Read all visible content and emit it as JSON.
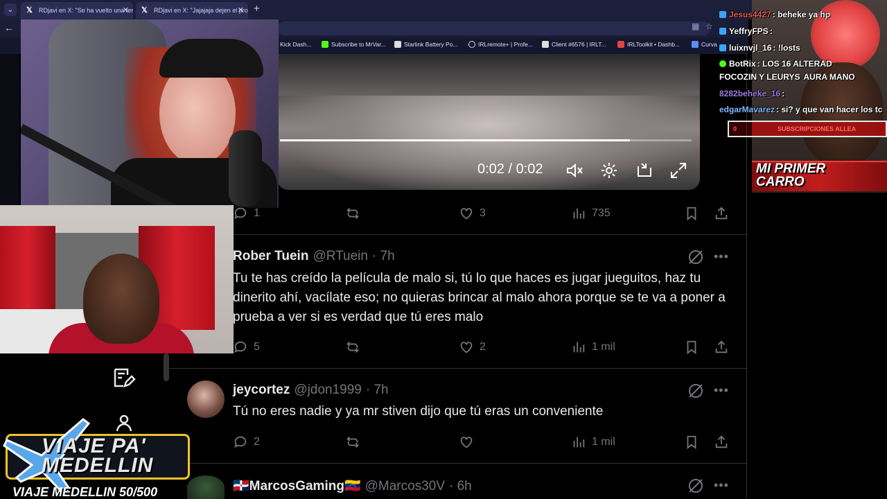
{
  "browser": {
    "tabs": [
      {
        "label": "RDjavi en X: \"Se ha vuelto una terc"
      },
      {
        "label": "RDjavi en X: \"Jajajaja dejen el prob"
      }
    ],
    "bookmarks": [
      {
        "label": "Kick Dash..."
      },
      {
        "label": "Subscribe to MrVar..."
      },
      {
        "label": "Starlink Battery Po..."
      },
      {
        "label": "IRLremote+ | Profe..."
      },
      {
        "label": "Client #6576 | IRLT..."
      },
      {
        "label": "IRLToolkit • Dashb..."
      },
      {
        "label": "Curva"
      }
    ]
  },
  "header": {
    "fragment": "t"
  },
  "video": {
    "time": "0:02 / 0:02",
    "progress_fraction": 0.85,
    "icons": [
      "mute-icon",
      "settings-icon",
      "pip-icon",
      "fullscreen-icon"
    ]
  },
  "post_actions": {
    "replies": "1",
    "likes": "3",
    "views": "735"
  },
  "replies": [
    {
      "name": "Rober Tuein",
      "handle": "@RTuein",
      "time": "· 7h",
      "text": "Tu te has creído la película de malo si, tú lo que haces es jugar jueguitos, haz tu dinerito ahí, vacílate eso; no quieras brincar al malo ahora porque se te va a poner a prueba a ver si es verdad que tú eres malo",
      "reply_count": "5",
      "like_count": "2",
      "views": "1 mil"
    },
    {
      "name": "jeycortez",
      "handle": "@jdon1999",
      "time": "· 7h",
      "text": "Tú no eres nadie y ya mr stiven dijo que tú eras un conveniente",
      "reply_count": "2",
      "like_count": "",
      "views": "1 mil"
    },
    {
      "name": "MarcosGaming",
      "handle": "@Marcos30V",
      "time": "· 6h",
      "flag_left": "🇩🇴",
      "flag_right": "🇻🇪"
    }
  ],
  "chat": [
    {
      "user": "Jesus4427",
      "message": ": beheke ya hp",
      "color": "#e05a5a"
    },
    {
      "user": "YeffryFPS",
      "message": ":",
      "color": "#ffffff"
    },
    {
      "user": "luixnvjl_16",
      "message": ": !losts",
      "color": "#ffffff"
    },
    {
      "user": "BotRix",
      "message": ": LOS 16 ALTERAD",
      "color": "#ffffff"
    },
    {
      "user": "FOCOZIN Y LEURYS",
      "message": "AURA MANO",
      "color": "#ffffff"
    },
    {
      "user": "8282beheke_16",
      "message": ":",
      "color": "#9b7be0"
    },
    {
      "user": "edgarMavarez",
      "message": ": si? y que van hacer los tc",
      "color": "#7fb8ff"
    }
  ],
  "stream": {
    "banner": "MI PRIMER CARRO",
    "goal_left": "0",
    "goal_text": "SUBSCRIPCIONES ALLEA",
    "badge_text": "VIAJE PA' MEDELLIN",
    "ticker": "VIAJE MEDELLIN 50/500"
  }
}
